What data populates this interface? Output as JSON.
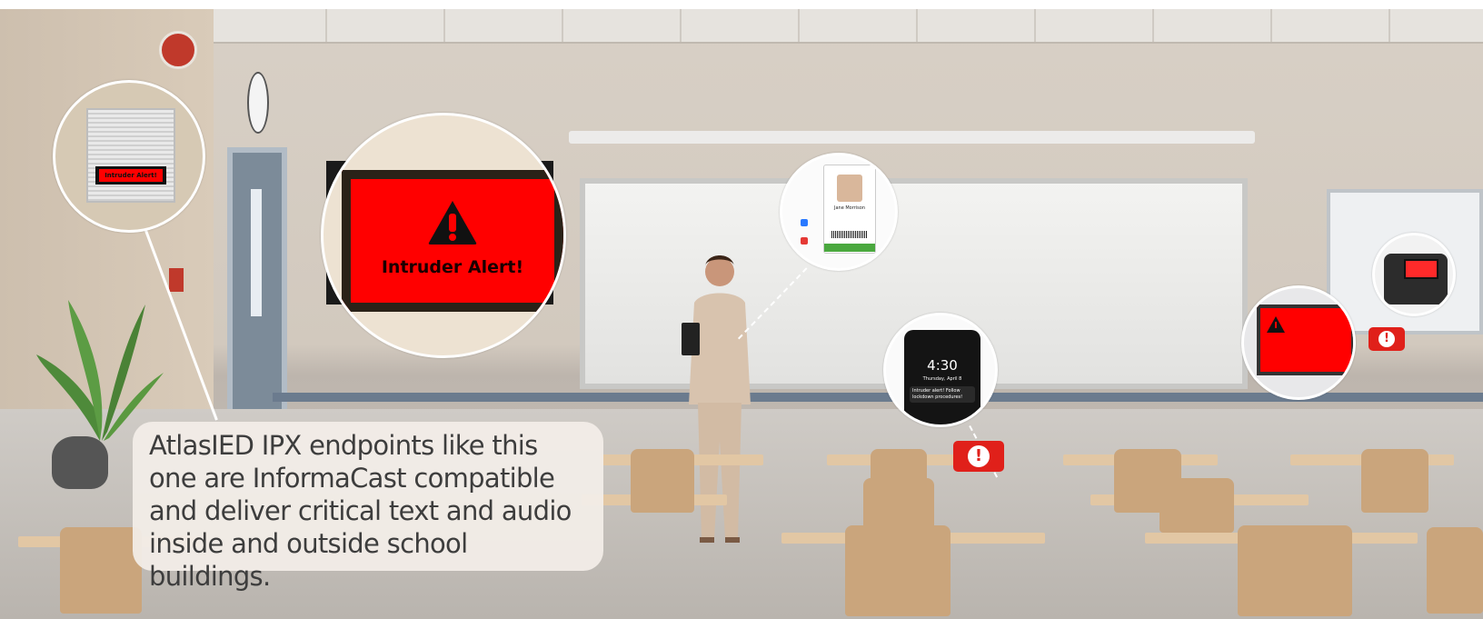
{
  "scene": {
    "caption": "AtlasIED IPX endpoints like this one are InformaCast compatible and deliver critical text and audio inside and outside school buildings.",
    "speaker_alert": "Intruder Alert!",
    "display_alert": "Intruder Alert!",
    "badge_name": "Jane Morrison",
    "phone_time": "4:30",
    "phone_date": "Thursday, April 8",
    "phone_notification": "Intruder alert! Follow lockdown procedures!",
    "alert_mark": "!"
  },
  "colors": {
    "alert_red": "#ff0000",
    "bubble_red": "#e0201a",
    "caption_text": "#3d3d3d",
    "badge_green": "#4aa83e"
  }
}
